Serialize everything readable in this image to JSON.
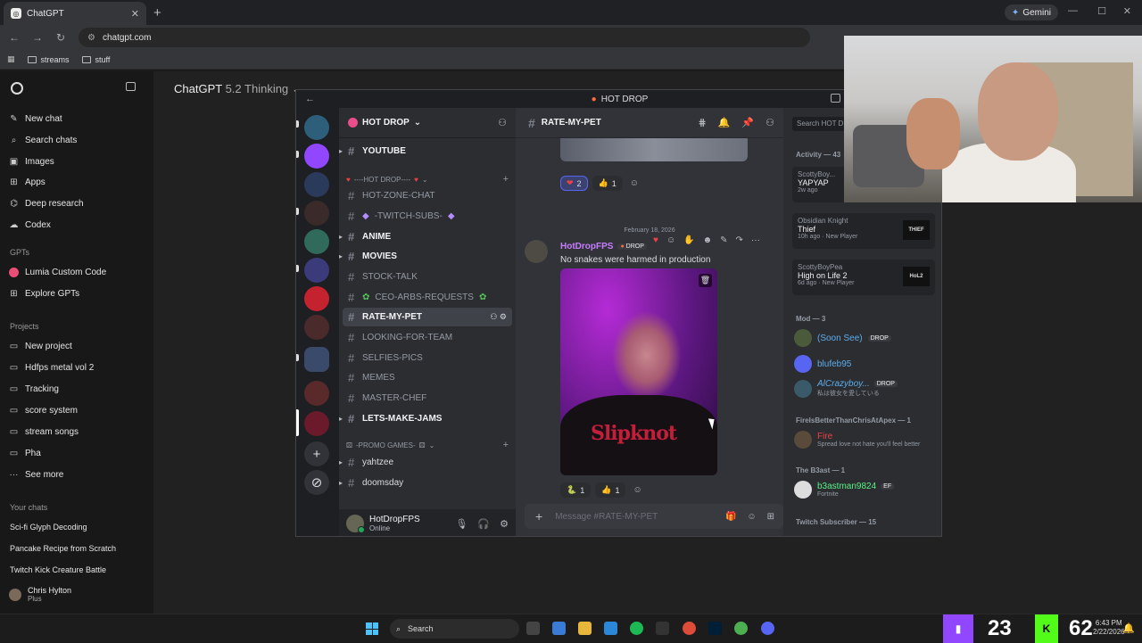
{
  "browser": {
    "tab_title": "ChatGPT",
    "url": "chatgpt.com",
    "gemini_label": "Gemini",
    "bookmarks": [
      "streams",
      "stuff"
    ]
  },
  "chatgpt": {
    "nav": [
      "New chat",
      "Search chats",
      "Images",
      "Apps",
      "Deep research",
      "Codex"
    ],
    "gpts_header": "GPTs",
    "gpts": [
      "Lumia Custom Code",
      "Explore GPTs"
    ],
    "projects_header": "Projects",
    "projects": [
      "New project",
      "Hdfps metal vol 2",
      "Tracking",
      "score system",
      "stream songs",
      "Pha",
      "See more"
    ],
    "chats_header": "Your chats",
    "chats": [
      "Sci-fi Glyph Decoding",
      "Pancake Recipe from Scratch",
      "Twitch Kick Creature Battle"
    ],
    "user_name": "Chris Hylton",
    "user_plan": "Plus",
    "model": "ChatGPT",
    "model_version": "5.2 Thinking"
  },
  "discord": {
    "window_title": "HOT DROP",
    "server_name": "HOT DROP",
    "channels": [
      {
        "name": "YOUTUBE",
        "style": "bold",
        "caret": true
      },
      {
        "category": "----HOT DROP----",
        "hearts": true
      },
      {
        "name": "HOT-ZONE-CHAT",
        "style": "normal"
      },
      {
        "name": "-TWITCH-SUBS-",
        "style": "normal",
        "gem": true
      },
      {
        "name": "ANIME",
        "style": "bold",
        "caret": true
      },
      {
        "name": "MOVIES",
        "style": "bold",
        "caret": true
      },
      {
        "name": "STOCK-TALK",
        "style": "normal"
      },
      {
        "name": "CEO-ARBS-REQUESTS",
        "style": "normal",
        "plant": true
      },
      {
        "name": "RATE-MY-PET",
        "style": "active"
      },
      {
        "name": "LOOKING-FOR-TEAM",
        "style": "normal"
      },
      {
        "name": "SELFIES-PICS",
        "style": "normal"
      },
      {
        "name": "MEMES",
        "style": "normal"
      },
      {
        "name": "MASTER-CHEF",
        "style": "normal"
      },
      {
        "name": "LETS-MAKE-JAMS",
        "style": "bold",
        "caret": true
      },
      {
        "category": "-PROMO GAMES-",
        "dice": true
      },
      {
        "name": "yahtzee",
        "style": "promo",
        "caret": true
      },
      {
        "name": "doomsday",
        "style": "promo",
        "caret": true
      }
    ],
    "current_user": {
      "name": "HotDropFPS",
      "status": "Online"
    },
    "channel_name": "RATE-MY-PET",
    "reaction_top": [
      {
        "emoji": "❤",
        "count": "2",
        "me": true
      },
      {
        "emoji": "👍",
        "count": "1",
        "me": false
      }
    ],
    "date_divider": "February 18, 2026",
    "message": {
      "author": "HotDropFPS",
      "tag": "DROP",
      "text": "No snakes were harmed in production"
    },
    "photo_shirt_text": "Slipknot",
    "reaction_bottom": [
      {
        "emoji": "🐍",
        "count": "1",
        "me": false
      },
      {
        "emoji": "👍",
        "count": "1",
        "me": false
      }
    ],
    "composer_placeholder": "Message #RATE-MY-PET",
    "search_placeholder": "Search HOT D",
    "members": {
      "activity_header": "Activity — 43",
      "activities": [
        {
          "user": "ScottyBoy...",
          "game": "YAPYAP",
          "detail": "2w ago"
        },
        {
          "user": "Obsidian Knight",
          "game": "Thief",
          "detail": "10h ago · New Player",
          "thumb": "THIEF"
        },
        {
          "user": "ScottyBoyPea",
          "game": "High on Life 2",
          "detail": "6d ago · New Player",
          "thumb": "HoL2"
        }
      ],
      "mod_header": "Mod — 3",
      "mods": [
        {
          "name": "(Soon See)",
          "badge": "DROP",
          "color": "#5dadec"
        },
        {
          "name": "blufeb95",
          "color": "#5dadec"
        },
        {
          "name": "AlCrazyboy...",
          "badge": "DROP",
          "sub": "私は彼女を愛している",
          "color": "#5dadec"
        }
      ],
      "group2_header": "FireIsBetterThanChrisAtApex — 1",
      "group2_member": {
        "name": "Fire",
        "sub": "Spread love not hate you'll feel better",
        "color": "#ed4245"
      },
      "group3_header": "The B3ast — 1",
      "group3_member": {
        "name": "b3astman9824",
        "badge": "EF",
        "sub": "Fortnite",
        "color": "#57f287"
      },
      "group4_header": "Twitch Subscriber — 15"
    }
  },
  "taskbar": {
    "search_label": "Search",
    "twitch_count": "23",
    "kick_count": "62",
    "time": "6:43 PM",
    "date": "2/22/2026"
  },
  "colors": {
    "discord_accent": "#5865f2",
    "twitch": "#9146ff",
    "kick": "#53fc18"
  }
}
